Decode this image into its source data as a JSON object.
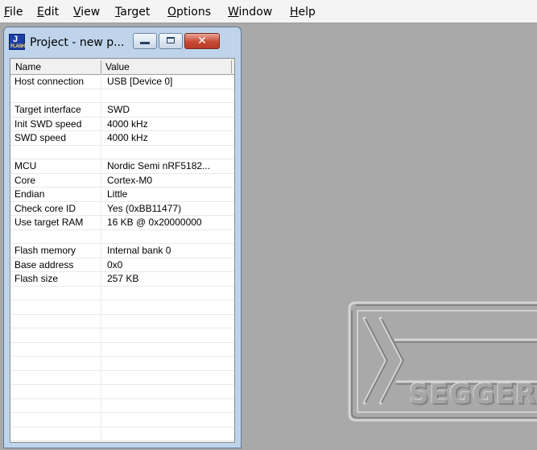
{
  "menu": [
    {
      "accel": "F",
      "rest": "ile"
    },
    {
      "accel": "E",
      "rest": "dit"
    },
    {
      "accel": "V",
      "rest": "iew"
    },
    {
      "accel": "T",
      "rest": "arget"
    },
    {
      "accel": "O",
      "rest": "ptions"
    },
    {
      "accel": "W",
      "rest": "indow"
    },
    {
      "accel": "H",
      "rest": "elp"
    }
  ],
  "window": {
    "title": "Project - new p...",
    "icon": "jflash-app-icon",
    "icon_text_top": "J",
    "icon_text_bottom": "FLASH",
    "close_glyph": "✕"
  },
  "grid": {
    "columns": [
      "Name",
      "Value"
    ],
    "rows": [
      {
        "name": "Host connection",
        "value": "USB [Device 0]"
      },
      {
        "name": "",
        "value": ""
      },
      {
        "name": "Target interface",
        "value": "SWD"
      },
      {
        "name": "Init SWD speed",
        "value": "4000 kHz"
      },
      {
        "name": "SWD speed",
        "value": "4000 kHz"
      },
      {
        "name": "",
        "value": ""
      },
      {
        "name": "MCU",
        "value": "Nordic Semi nRF5182..."
      },
      {
        "name": "Core",
        "value": "Cortex-M0"
      },
      {
        "name": "Endian",
        "value": "Little"
      },
      {
        "name": "Check core ID",
        "value": "Yes (0xBB11477)"
      },
      {
        "name": "Use target RAM",
        "value": "16 KB @ 0x20000000"
      },
      {
        "name": "",
        "value": ""
      },
      {
        "name": "Flash memory",
        "value": "Internal bank 0"
      },
      {
        "name": "Base address",
        "value": "0x0"
      },
      {
        "name": "Flash size",
        "value": "257 KB"
      },
      {
        "name": "",
        "value": ""
      },
      {
        "name": "",
        "value": ""
      },
      {
        "name": "",
        "value": ""
      },
      {
        "name": "",
        "value": ""
      },
      {
        "name": "",
        "value": ""
      },
      {
        "name": "",
        "value": ""
      },
      {
        "name": "",
        "value": ""
      },
      {
        "name": "",
        "value": ""
      },
      {
        "name": "",
        "value": ""
      },
      {
        "name": "",
        "value": ""
      },
      {
        "name": "",
        "value": ""
      }
    ]
  },
  "logo": {
    "text": "SEGGER"
  }
}
